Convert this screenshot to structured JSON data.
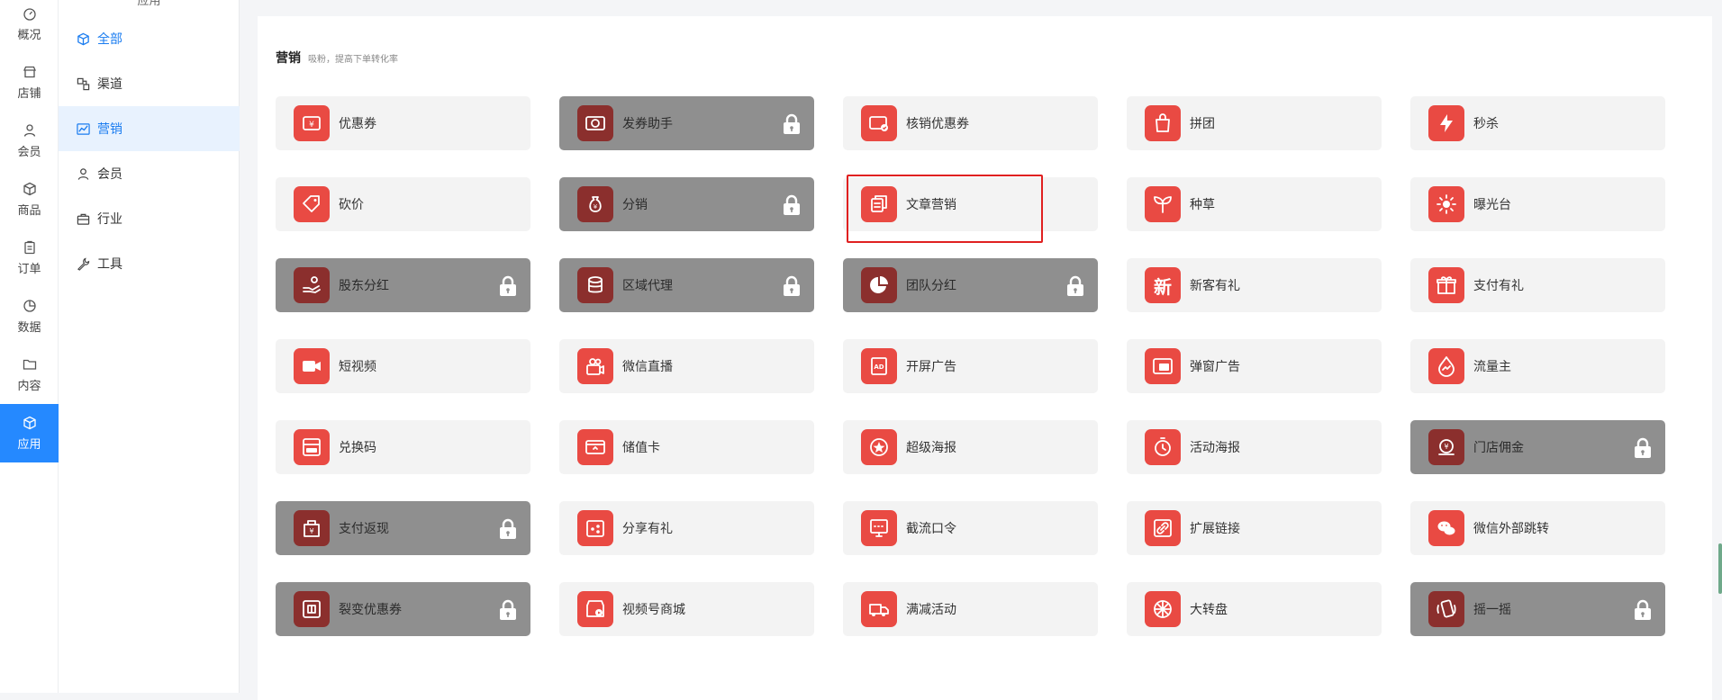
{
  "rail": {
    "items": [
      {
        "label": "概况",
        "icon": "dashboard-icon"
      },
      {
        "label": "店铺",
        "icon": "store-icon"
      },
      {
        "label": "会员",
        "icon": "user-icon"
      },
      {
        "label": "商品",
        "icon": "box-icon"
      },
      {
        "label": "订单",
        "icon": "clipboard-icon"
      },
      {
        "label": "数据",
        "icon": "pie-icon"
      },
      {
        "label": "内容",
        "icon": "folder-icon"
      },
      {
        "label": "应用",
        "icon": "cube-icon",
        "active": true
      }
    ]
  },
  "subnav": {
    "title": "应用",
    "items": [
      {
        "label": "全部",
        "icon": "cube-icon"
      },
      {
        "label": "渠道",
        "icon": "channel-icon"
      },
      {
        "label": "营销",
        "icon": "trend-icon",
        "active": true
      },
      {
        "label": "会员",
        "icon": "user-icon"
      },
      {
        "label": "行业",
        "icon": "briefcase-icon"
      },
      {
        "label": "工具",
        "icon": "wrench-icon"
      }
    ]
  },
  "section": {
    "title": "营销",
    "subtitle": "吸粉，提高下单转化率"
  },
  "tiles": [
    {
      "label": "优惠券",
      "icon": "coupon-icon",
      "locked": false
    },
    {
      "label": "发券助手",
      "icon": "coupon-helper-icon",
      "locked": true
    },
    {
      "label": "核销优惠券",
      "icon": "verify-coupon-icon",
      "locked": false
    },
    {
      "label": "拼团",
      "icon": "group-buy-icon",
      "locked": false
    },
    {
      "label": "秒杀",
      "icon": "flash-sale-icon",
      "locked": false
    },
    {
      "label": "砍价",
      "icon": "bargain-icon",
      "locked": false
    },
    {
      "label": "分销",
      "icon": "money-bag-icon",
      "locked": true
    },
    {
      "label": "文章营销",
      "icon": "article-icon",
      "locked": false
    },
    {
      "label": "种草",
      "icon": "sprout-icon",
      "locked": false
    },
    {
      "label": "曝光台",
      "icon": "sun-icon",
      "locked": false
    },
    {
      "label": "股东分红",
      "icon": "hand-coins-icon",
      "locked": true
    },
    {
      "label": "区域代理",
      "icon": "database-icon",
      "locked": true
    },
    {
      "label": "团队分红",
      "icon": "pie-chart-icon",
      "locked": true
    },
    {
      "label": "新客有礼",
      "icon": "new-glyph-icon",
      "glyph": "新",
      "locked": false
    },
    {
      "label": "支付有礼",
      "icon": "gift-icon",
      "locked": false
    },
    {
      "label": "短视频",
      "icon": "video-camera-icon",
      "locked": false
    },
    {
      "label": "微信直播",
      "icon": "live-camera-icon",
      "locked": false
    },
    {
      "label": "开屏广告",
      "icon": "ad-screen-icon",
      "locked": false
    },
    {
      "label": "弹窗广告",
      "icon": "popup-ad-icon",
      "locked": false
    },
    {
      "label": "流量主",
      "icon": "flow-drop-icon",
      "locked": false
    },
    {
      "label": "兑换码",
      "icon": "redeem-code-icon",
      "locked": false
    },
    {
      "label": "储值卡",
      "icon": "stored-card-icon",
      "locked": false
    },
    {
      "label": "超级海报",
      "icon": "star-poster-icon",
      "locked": false
    },
    {
      "label": "活动海报",
      "icon": "timer-icon",
      "locked": false
    },
    {
      "label": "门店佣金",
      "icon": "store-commission-icon",
      "locked": true
    },
    {
      "label": "支付返现",
      "icon": "cashback-icon",
      "locked": true
    },
    {
      "label": "分享有礼",
      "icon": "share-gift-icon",
      "locked": false
    },
    {
      "label": "截流口令",
      "icon": "password-icon",
      "locked": false
    },
    {
      "label": "扩展链接",
      "icon": "link-icon",
      "locked": false
    },
    {
      "label": "微信外部跳转",
      "icon": "wechat-icon",
      "locked": false
    },
    {
      "label": "裂变优惠券",
      "icon": "fission-coupon-icon",
      "locked": true
    },
    {
      "label": "视频号商城",
      "icon": "video-shop-icon",
      "locked": false
    },
    {
      "label": "满减活动",
      "icon": "discount-truck-icon",
      "locked": false
    },
    {
      "label": "大转盘",
      "icon": "wheel-icon",
      "locked": false
    },
    {
      "label": "摇一摇",
      "icon": "shake-icon",
      "locked": true
    }
  ],
  "colors": {
    "accent": "#2589ff",
    "tile_icon": "#e94a43",
    "locked_tile": "#8f8f8f",
    "highlight": "#e02020"
  }
}
